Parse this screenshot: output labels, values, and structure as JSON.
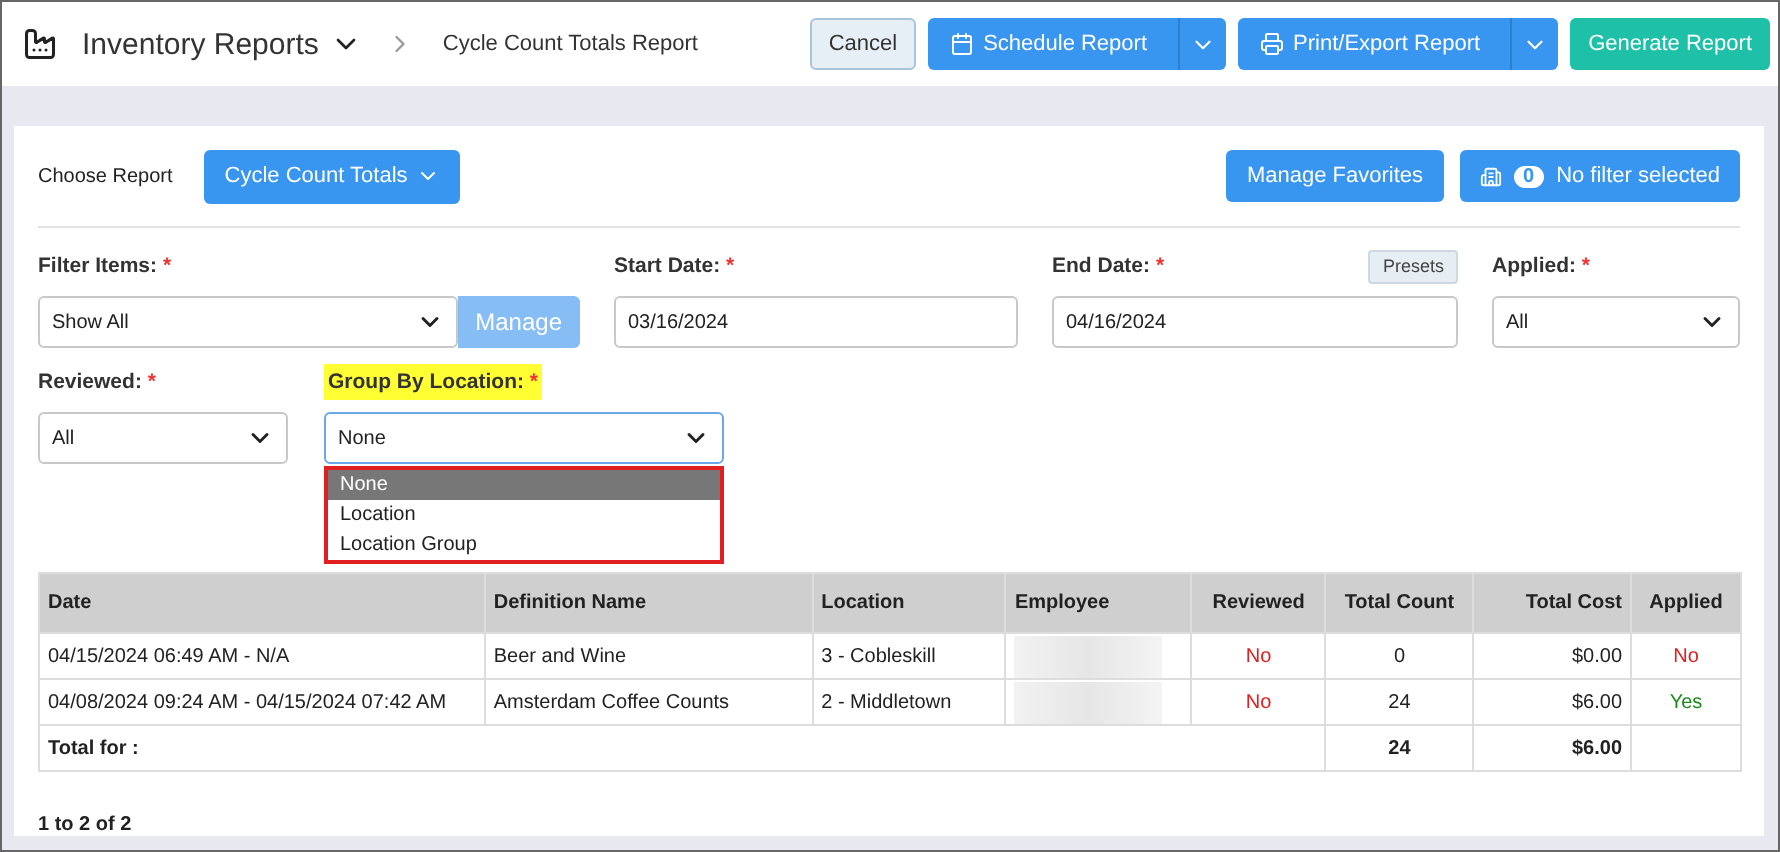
{
  "header": {
    "title": "Inventory Reports",
    "breadcrumb": "Cycle Count Totals Report",
    "buttons": [
      {
        "kind": "plain",
        "label": "Cancel"
      },
      {
        "kind": "split",
        "label": "Schedule Report"
      },
      {
        "kind": "split",
        "label": "Print/Export Report"
      },
      {
        "kind": "accent",
        "label": "Generate Report"
      }
    ]
  },
  "report_bar": {
    "label": "Choose Report",
    "report": "Cycle Count Totals",
    "favorites": "Manage Favorites",
    "filter_count": "0",
    "filter_text": "No filter selected"
  },
  "filters": {
    "filter_items": {
      "label": "Filter Items:",
      "value": "Show All",
      "button": "Manage"
    },
    "start_date": {
      "label": "Start Date:",
      "value": "03/16/2024"
    },
    "end_date": {
      "label": "End Date:",
      "value": "04/16/2024",
      "presets": "Presets"
    },
    "applied": {
      "label": "Applied:",
      "value": "All"
    },
    "reviewed": {
      "label": "Reviewed:",
      "value": "All"
    },
    "group_by": {
      "label": "Group By Location:",
      "value": "None",
      "highlighted": true,
      "expanded": true,
      "options": [
        {
          "label": "None",
          "selected": true
        },
        {
          "label": "Location",
          "selected": false
        },
        {
          "label": "Location Group",
          "selected": false
        }
      ]
    },
    "required_mark": "*"
  },
  "table": {
    "columns": [
      "Date",
      "Definition Name",
      "Location",
      "Employee",
      "Reviewed",
      "Total Count",
      "Total Cost",
      "Applied"
    ],
    "rows": [
      {
        "date": "04/15/2024 06:49 AM - N/A",
        "definition": "Beer and Wine",
        "location": "3 - Cobleskill",
        "reviewed": {
          "text": "No",
          "positive": false
        },
        "total_count": "0",
        "total_cost": "$0.00",
        "applied": {
          "text": "No",
          "positive": false
        }
      },
      {
        "date": "04/08/2024 09:24 AM - 04/15/2024 07:42 AM",
        "definition": "Amsterdam Coffee Counts",
        "location": "2 - Middletown",
        "reviewed": {
          "text": "No",
          "positive": false
        },
        "total_count": "24",
        "total_cost": "$6.00",
        "applied": {
          "text": "Yes",
          "positive": true
        }
      }
    ],
    "total": {
      "label": "Total for :",
      "total_count": "24",
      "total_cost": "$6.00"
    }
  },
  "pagination": "1 to 2 of 2"
}
